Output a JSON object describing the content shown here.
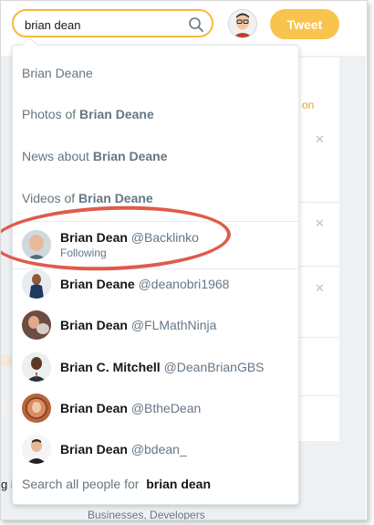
{
  "search": {
    "value": "brian dean"
  },
  "tweet_button": {
    "label": "Tweet"
  },
  "suggestions": {
    "plain": "Brian Deane",
    "photos": {
      "prefix": "Photos of ",
      "term": "Brian Deane"
    },
    "news": {
      "prefix": "News about ",
      "term": "Brian Deane"
    },
    "videos": {
      "prefix": "Videos of ",
      "term": "Brian Deane"
    }
  },
  "users": [
    {
      "name": "Brian Dean",
      "handle": "@Backlinko",
      "sub": "Following",
      "avatar": "bald-man-avatar"
    },
    {
      "name": "Brian Deane",
      "handle": "@deanobri1968",
      "sub": "",
      "avatar": "man-in-navy-shirt-avatar"
    },
    {
      "name": "Brian Dean",
      "handle": "@FLMathNinja",
      "sub": "",
      "avatar": "man-with-dog-avatar"
    },
    {
      "name": "Brian C. Mitchell",
      "handle": "@DeanBrianGBS",
      "sub": "",
      "avatar": "man-in-suit-avatar"
    },
    {
      "name": "Brian Dean",
      "handle": "@BtheDean",
      "sub": "",
      "avatar": "illustrated-avatar"
    },
    {
      "name": "Brian Dean",
      "handle": "@bdean_",
      "sub": "",
      "avatar": "man-in-dark-suit-avatar"
    }
  ],
  "search_all": {
    "prefix": "Search all people for ",
    "term": "brian dean"
  },
  "background": {
    "orange_fragment": "on",
    "left_fragment": "g i",
    "bottom_fragment": "Businesses, Developers"
  },
  "colors": {
    "accent": "#f5b93c",
    "tweet": "#f9c34d",
    "annotation": "#e05a4a"
  }
}
